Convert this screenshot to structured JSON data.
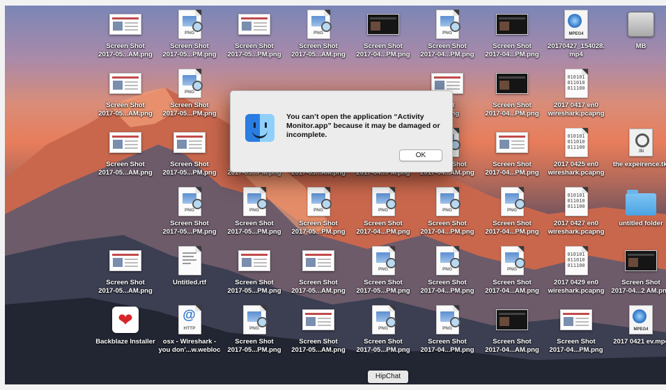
{
  "dialog": {
    "message": "You can’t open the application “Activity Monitor.app” because it may be damaged or incomplete.",
    "ok_label": "OK",
    "icon": "finder-icon"
  },
  "tooltip": "HipChat",
  "icons": [
    {
      "kind": "shot",
      "l1": "Screen Shot",
      "l2": "2017-05...AM.png"
    },
    {
      "kind": "png",
      "badge": "PNG",
      "l1": "Screen Shot",
      "l2": "2017-05...PM.png"
    },
    {
      "kind": "shot",
      "l1": "Screen Shot",
      "l2": "2017-05...PM.png"
    },
    {
      "kind": "png",
      "badge": "PNG",
      "l1": "Screen Shot",
      "l2": "2017-05...AM.png"
    },
    {
      "kind": "shotdark",
      "l1": "Screen Shot",
      "l2": "2017-04...PM.png"
    },
    {
      "kind": "png",
      "badge": "PNG",
      "l1": "Screen Shot",
      "l2": "2017-04...PM.png"
    },
    {
      "kind": "shotdark",
      "l1": "Screen Shot",
      "l2": "2017-04...PM.png"
    },
    {
      "kind": "mpeg",
      "badge": "MPEG4",
      "l1": "20170427_154028.",
      "l2": "mp4"
    },
    {
      "kind": "drive",
      "l1": "MB",
      "l2": ""
    },
    {
      "kind": "shot",
      "l1": "Screen Shot",
      "l2": "2017-05...AM.png"
    },
    {
      "kind": "png",
      "badge": "PNG",
      "l1": "Screen Shot",
      "l2": "2017-05...PM.png"
    },
    {
      "kind": "hidden",
      "l1": "",
      "l2": ""
    },
    {
      "kind": "hidden",
      "l1": "",
      "l2": ""
    },
    {
      "kind": "hidden",
      "l1": "",
      "l2": ""
    },
    {
      "kind": "shot",
      "l1": "Shot",
      "l2": "PM.png"
    },
    {
      "kind": "shotdark",
      "l1": "Screen Shot",
      "l2": "2017-04...PM.png"
    },
    {
      "kind": "code",
      "bin": "010101\n011010\n011100",
      "l1": "2017 0417 en0",
      "l2": "wireshark.pcapng"
    },
    {
      "kind": "hidden",
      "l1": "",
      "l2": ""
    },
    {
      "kind": "shot",
      "l1": "Screen Shot",
      "l2": "2017-05...AM.png"
    },
    {
      "kind": "shot",
      "l1": "Screen Shot",
      "l2": "2017-05...PM.png"
    },
    {
      "kind": "png",
      "badge": "PNG",
      "l1": "Screen Shot",
      "l2": "2017-05...PM.png"
    },
    {
      "kind": "png",
      "badge": "PNG",
      "l1": "Screen Shot",
      "l2": "2017-05...AM.png"
    },
    {
      "kind": "png",
      "badge": "PNG",
      "l1": "Screen Shot",
      "l2": "2017-04...PM.png"
    },
    {
      "kind": "png",
      "badge": "PNG",
      "l1": "Screen Shot",
      "l2": "2017-04...AM.png"
    },
    {
      "kind": "shot",
      "l1": "Screen Shot",
      "l2": "2017-04...PM.png"
    },
    {
      "kind": "code",
      "bin": "010101\n011010\n011100",
      "l1": "2017 0425 en0",
      "l2": "wireshark.pcapng"
    },
    {
      "kind": "tool",
      "badge": ".tki",
      "l1": "the expeirence.tki",
      "l2": ""
    },
    {
      "kind": "hidden",
      "l1": "",
      "l2": ""
    },
    {
      "kind": "png",
      "badge": "PNG",
      "l1": "Screen Shot",
      "l2": "2017-05...PM.png"
    },
    {
      "kind": "png",
      "badge": "PNG",
      "l1": "Screen Shot",
      "l2": "2017-05...PM.png"
    },
    {
      "kind": "png",
      "badge": "PNG",
      "l1": "Screen Shot",
      "l2": "2017-05...PM.png"
    },
    {
      "kind": "png",
      "badge": "PNG",
      "l1": "Screen Shot",
      "l2": "2017-04...PM.png"
    },
    {
      "kind": "png",
      "badge": "PNG",
      "l1": "Screen Shot",
      "l2": "2017-04...PM.png"
    },
    {
      "kind": "png",
      "badge": "PNG",
      "l1": "Screen Shot",
      "l2": "2017-04...PM.png"
    },
    {
      "kind": "code",
      "bin": "010101\n011010\n011100",
      "l1": "2017 0427 en0",
      "l2": "wireshark.pcapng"
    },
    {
      "kind": "folder",
      "l1": "untitled folder",
      "l2": ""
    },
    {
      "kind": "shot",
      "l1": "Screen Shot",
      "l2": "2017-05...AM.png"
    },
    {
      "kind": "rtf",
      "l1": "Untitled.rtf",
      "l2": ""
    },
    {
      "kind": "shot",
      "l1": "Screen Shot",
      "l2": "2017-05...PM.png"
    },
    {
      "kind": "shot",
      "l1": "Screen Shot",
      "l2": "2017-05...AM.png"
    },
    {
      "kind": "png",
      "badge": "PNG",
      "l1": "Screen Shot",
      "l2": "2017-05...PM.png"
    },
    {
      "kind": "png",
      "badge": "PNG",
      "l1": "Screen Shot",
      "l2": "2017-04...PM.png"
    },
    {
      "kind": "png",
      "badge": "PNG",
      "l1": "Screen Shot",
      "l2": "2017-04...AM.png"
    },
    {
      "kind": "code",
      "bin": "010101\n011010\n011100",
      "l1": "2017 0429 en0",
      "l2": "wireshark.pcapng"
    },
    {
      "kind": "shotdark",
      "l1": "Screen Shot",
      "l2": "2017-04...2 AM.png"
    },
    {
      "kind": "backblaze",
      "l1": "Backblaze Installer",
      "l2": ""
    },
    {
      "kind": "http",
      "badge": "HTTP",
      "l1": "osx - Wireshark -",
      "l2": "you don'...w.webloc"
    },
    {
      "kind": "png",
      "badge": "PNG",
      "l1": "Screen Shot",
      "l2": "2017-05...PM.png"
    },
    {
      "kind": "shot",
      "l1": "Screen Shot",
      "l2": "2017-05...AM.png"
    },
    {
      "kind": "png",
      "badge": "PNG",
      "l1": "Screen Shot",
      "l2": "2017-05...PM.png"
    },
    {
      "kind": "png",
      "badge": "PNG",
      "l1": "Screen Shot",
      "l2": "2017-04...PM.png"
    },
    {
      "kind": "shotdark",
      "l1": "Screen Shot",
      "l2": "2017-04...AM.png"
    },
    {
      "kind": "shot",
      "l1": "Screen Shot",
      "l2": "2017-04...PM.png"
    },
    {
      "kind": "mpeg",
      "badge": "MPEG4",
      "l1": "2017 0421 ev.mp4",
      "l2": ""
    }
  ]
}
